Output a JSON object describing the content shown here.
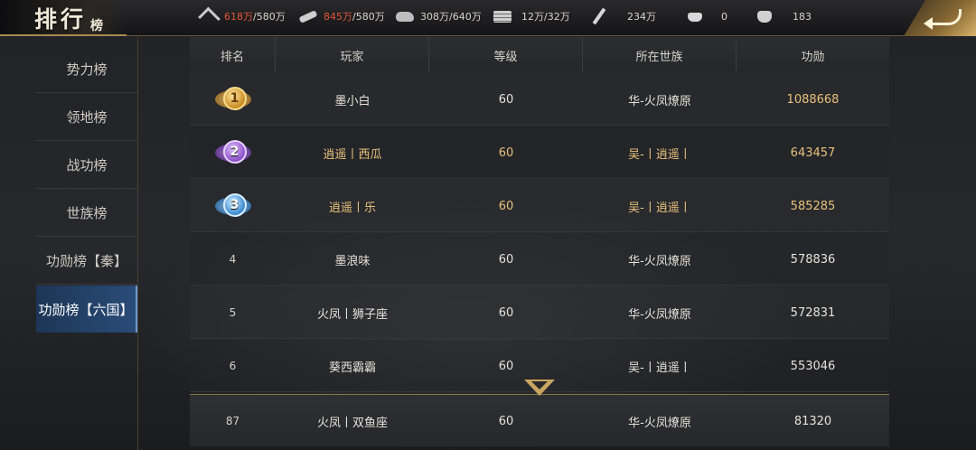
{
  "title": {
    "main": "排行",
    "sub": "榜"
  },
  "resources": {
    "grain": {
      "used": "618万",
      "cap": "/580万"
    },
    "wood": {
      "used": "845万",
      "cap": "/580万"
    },
    "stone": {
      "value": "308万/640万"
    },
    "iron": {
      "value": "12万/32万"
    },
    "merit": {
      "value": "234万"
    },
    "gold": {
      "value": "0"
    },
    "silver": {
      "value": "183"
    }
  },
  "sidebar": {
    "items": [
      {
        "label": "势力榜"
      },
      {
        "label": "领地榜"
      },
      {
        "label": "战功榜"
      },
      {
        "label": "世族榜"
      },
      {
        "label": "功勋榜【秦】"
      },
      {
        "label": "功勋榜【六国】"
      }
    ],
    "active_index": 5
  },
  "table": {
    "headers": [
      "排名",
      "玩家",
      "等级",
      "所在世族",
      "功勋"
    ],
    "rows": [
      {
        "rank": "1",
        "player": "墨小白",
        "level": "60",
        "clan": "华-火凤燎原",
        "merit": "1088668"
      },
      {
        "rank": "2",
        "player": "逍遥丨西瓜",
        "level": "60",
        "clan": "吴-丨逍遥丨",
        "merit": "643457"
      },
      {
        "rank": "3",
        "player": "逍遥丨乐",
        "level": "60",
        "clan": "吴-丨逍遥丨",
        "merit": "585285"
      },
      {
        "rank": "4",
        "player": "墨浪味",
        "level": "60",
        "clan": "华-火凤燎原",
        "merit": "578836"
      },
      {
        "rank": "5",
        "player": "火凤丨狮子座",
        "level": "60",
        "clan": "华-火凤燎原",
        "merit": "572831"
      },
      {
        "rank": "6",
        "player": "葵西霸霸",
        "level": "60",
        "clan": "吴-丨逍遥丨",
        "merit": "553046"
      }
    ],
    "self_row": {
      "rank": "87",
      "player": "火凤丨双鱼座",
      "level": "60",
      "clan": "华-火凤燎原",
      "merit": "81320"
    }
  },
  "colors": {
    "accent_gold": "#e8c07a",
    "resource_over": "#e0553a",
    "active_tab": "#2a4c78"
  },
  "icons": [
    "wheat-icon",
    "wood-icon",
    "stone-icon",
    "iron-icon",
    "sword-icon",
    "gold-ingot-icon",
    "silver-ingot-icon",
    "back-arrow-icon",
    "expand-chevron-icon"
  ]
}
